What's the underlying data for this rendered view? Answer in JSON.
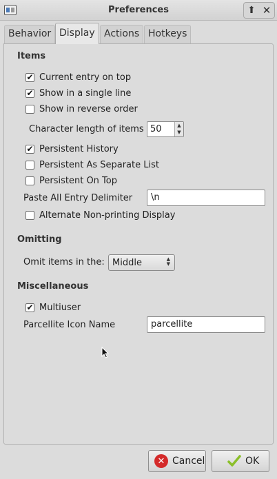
{
  "window": {
    "title": "Preferences"
  },
  "tabs": [
    {
      "label": "Behavior",
      "active": false
    },
    {
      "label": "Display",
      "active": true
    },
    {
      "label": "Actions",
      "active": false
    },
    {
      "label": "Hotkeys",
      "active": false
    }
  ],
  "items_section": {
    "title": "Items",
    "current_entry_on_top": {
      "label": "Current entry on top",
      "checked": true
    },
    "show_single_line": {
      "label": "Show in a single line",
      "checked": true
    },
    "show_reverse_order": {
      "label": "Show in reverse order",
      "checked": false
    },
    "character_length": {
      "label": "Character length of items",
      "value": "50"
    },
    "persistent_history": {
      "label": "Persistent History",
      "checked": true
    },
    "persistent_separate": {
      "label": "Persistent As Separate List",
      "checked": false
    },
    "persistent_on_top": {
      "label": "Persistent On Top",
      "checked": false
    },
    "paste_delimiter": {
      "label": "Paste All Entry Delimiter",
      "value": "\\n"
    },
    "alternate_nonprinting": {
      "label": "Alternate Non-printing Display",
      "checked": false
    }
  },
  "omitting_section": {
    "title": "Omitting",
    "omit_items": {
      "label": "Omit items in the:",
      "selected": "Middle"
    }
  },
  "misc_section": {
    "title": "Miscellaneous",
    "multiuser": {
      "label": "Multiuser",
      "checked": true
    },
    "icon_name": {
      "label": "Parcellite Icon Name",
      "value": "parcellite"
    }
  },
  "buttons": {
    "cancel": "Cancel",
    "ok": "OK"
  },
  "colors": {
    "cancel_icon": "#d42a2a",
    "ok_check": "#8bbf2a"
  }
}
